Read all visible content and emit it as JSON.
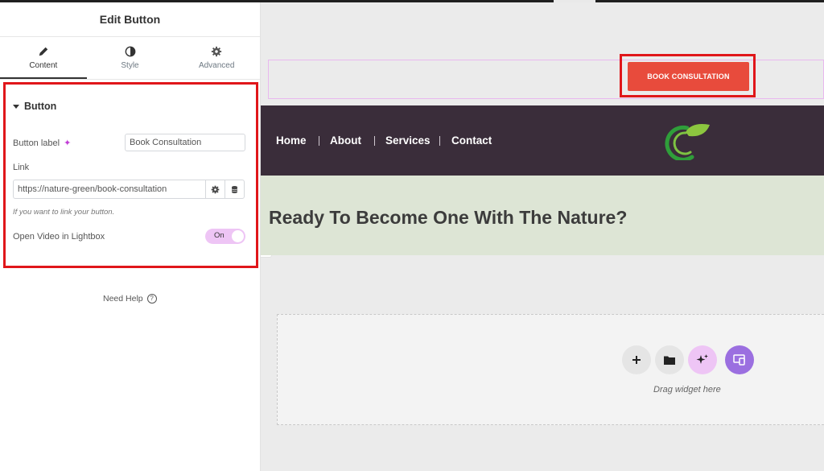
{
  "panel": {
    "title": "Edit Button",
    "tabs": [
      {
        "label": "Content",
        "icon": "pencil-icon"
      },
      {
        "label": "Style",
        "icon": "half-circle-icon"
      },
      {
        "label": "Advanced",
        "icon": "gear-icon"
      }
    ],
    "section_title": "Button",
    "button_label": {
      "label": "Button label",
      "value": "Book Consultation"
    },
    "link": {
      "label": "Link",
      "value": "https://nature-green/book-consultation"
    },
    "link_hint": "If you want to link your button.",
    "lightbox": {
      "label": "Open Video in Lightbox",
      "toggle_text": "On",
      "enabled": true
    },
    "need_help": "Need Help",
    "help_icon": "?"
  },
  "canvas": {
    "book_button_label": "BOOK CONSULTATION",
    "nav": [
      "Home",
      "About",
      "Services",
      "Contact"
    ],
    "hero_title": "Ready To Become One With The Nature?",
    "drop_zone_text": "Drag widget here"
  },
  "colors": {
    "accent_red": "#e0161a",
    "button_red": "#e84b3c",
    "nav_bg": "#3a2d3a",
    "hero_bg": "#dde5d5",
    "toggle_bg": "#eec5f5",
    "ai_purple": "#9b6fe0"
  }
}
